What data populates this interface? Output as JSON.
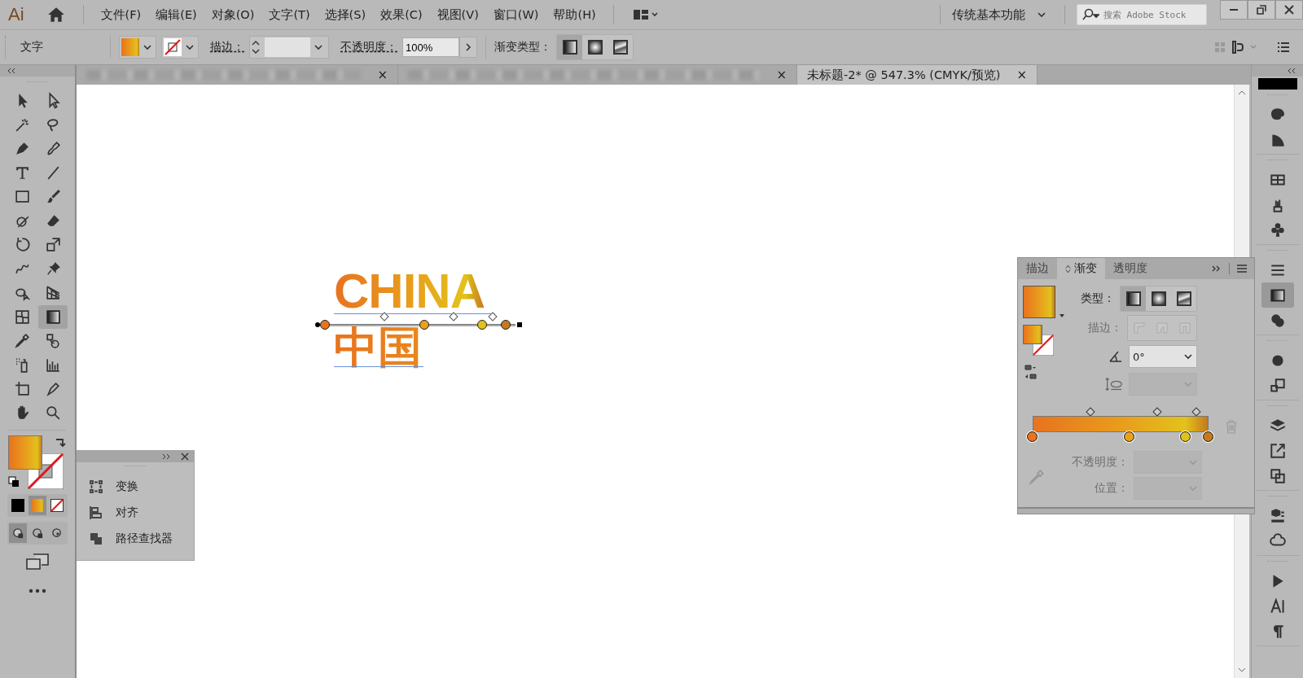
{
  "app": {
    "logo": "Ai"
  },
  "menu": [
    "文件(F)",
    "编辑(E)",
    "对象(O)",
    "文字(T)",
    "选择(S)",
    "效果(C)",
    "视图(V)",
    "窗口(W)",
    "帮助(H)"
  ],
  "workspace": {
    "label": "传统基本功能"
  },
  "search": {
    "placeholder": "搜索 Adobe Stock"
  },
  "control_bar": {
    "selection_label": "文字",
    "stroke_label": "描边：",
    "opacity_label": "不透明度：",
    "opacity_value": "100%",
    "gradient_type_label": "渐变类型：",
    "gradient_types": [
      {
        "selected": true
      },
      {
        "selected": false
      },
      {
        "selected": false
      }
    ]
  },
  "document_tabs": [
    {
      "kind": "blurred",
      "close": "×",
      "selected": false
    },
    {
      "kind": "blurred",
      "close": "×",
      "selected": false
    },
    {
      "kind": "named",
      "title": "未标题-2* @ 547.3% (CMYK/预览)",
      "close": "×",
      "selected": true
    }
  ],
  "toolbar": {
    "tools": [
      {
        "selected": false
      },
      {
        "selected": false
      },
      {
        "selected": false
      },
      {
        "selected": false
      },
      {
        "selected": false
      },
      {
        "selected": false
      },
      {
        "selected": false
      },
      {
        "selected": false
      },
      {
        "selected": false
      },
      {
        "selected": false
      },
      {
        "selected": false
      },
      {
        "selected": false
      },
      {
        "selected": false
      },
      {
        "selected": false
      },
      {
        "selected": false
      },
      {
        "selected": false
      },
      {
        "selected": false
      },
      {
        "selected": false
      },
      {
        "selected": false
      },
      {
        "selected": true
      },
      {
        "selected": false
      },
      {
        "selected": false
      },
      {
        "selected": false
      },
      {
        "selected": false
      },
      {
        "selected": false
      },
      {
        "selected": false
      },
      {
        "selected": false
      },
      {
        "selected": false
      }
    ],
    "fill_modes": [
      {
        "kind": "color",
        "selected": false
      },
      {
        "kind": "gradient",
        "selected": true
      },
      {
        "kind": "none",
        "selected": false
      }
    ],
    "draw_modes": [
      {
        "selected": true
      },
      {
        "selected": false
      },
      {
        "selected": false
      }
    ]
  },
  "canvas": {
    "text_line_1": "CHINA",
    "text_line_2": "中国"
  },
  "gradient": {
    "stops": [
      {
        "level": 0,
        "color": "#e8731e"
      },
      {
        "level": 0.55,
        "color": "#e8a11c"
      },
      {
        "level": 0.87,
        "color": "#e2c21c"
      },
      {
        "level": 1,
        "color": "#c47a1c"
      }
    ],
    "midpoints": [
      {
        "level": 0.33
      },
      {
        "level": 0.71
      },
      {
        "level": 0.93
      }
    ]
  },
  "floating_panel": {
    "items": [
      "变换",
      "对齐",
      "路径查找器"
    ]
  },
  "gradient_panel": {
    "tabs": [
      {
        "label": "描边",
        "selected": false
      },
      {
        "label": "渐变",
        "selected": true
      },
      {
        "label": "透明度",
        "selected": false
      }
    ],
    "type_label": "类型：",
    "types": [
      {
        "selected": true
      },
      {
        "selected": false
      },
      {
        "selected": false
      }
    ],
    "stroke_label": "描边：",
    "stroke_disabled": true,
    "angle": "0°",
    "opacity_label": "不透明度：",
    "position_label": "位置：",
    "stop_fields_disabled": true
  },
  "right_dock": {
    "items": [
      {
        "selected": false
      },
      {
        "selected": false
      },
      {
        "selected": false
      },
      {
        "selected": false
      },
      {
        "selected": false
      },
      {
        "selected": false
      },
      {
        "selected": true
      },
      {
        "selected": false
      },
      {
        "selected": false
      },
      {
        "selected": false
      },
      {
        "selected": false
      },
      {
        "selected": false
      },
      {
        "selected": false
      },
      {
        "selected": false
      },
      {
        "selected": false
      },
      {
        "selected": false
      },
      {
        "selected": false
      },
      {
        "selected": false
      }
    ]
  }
}
